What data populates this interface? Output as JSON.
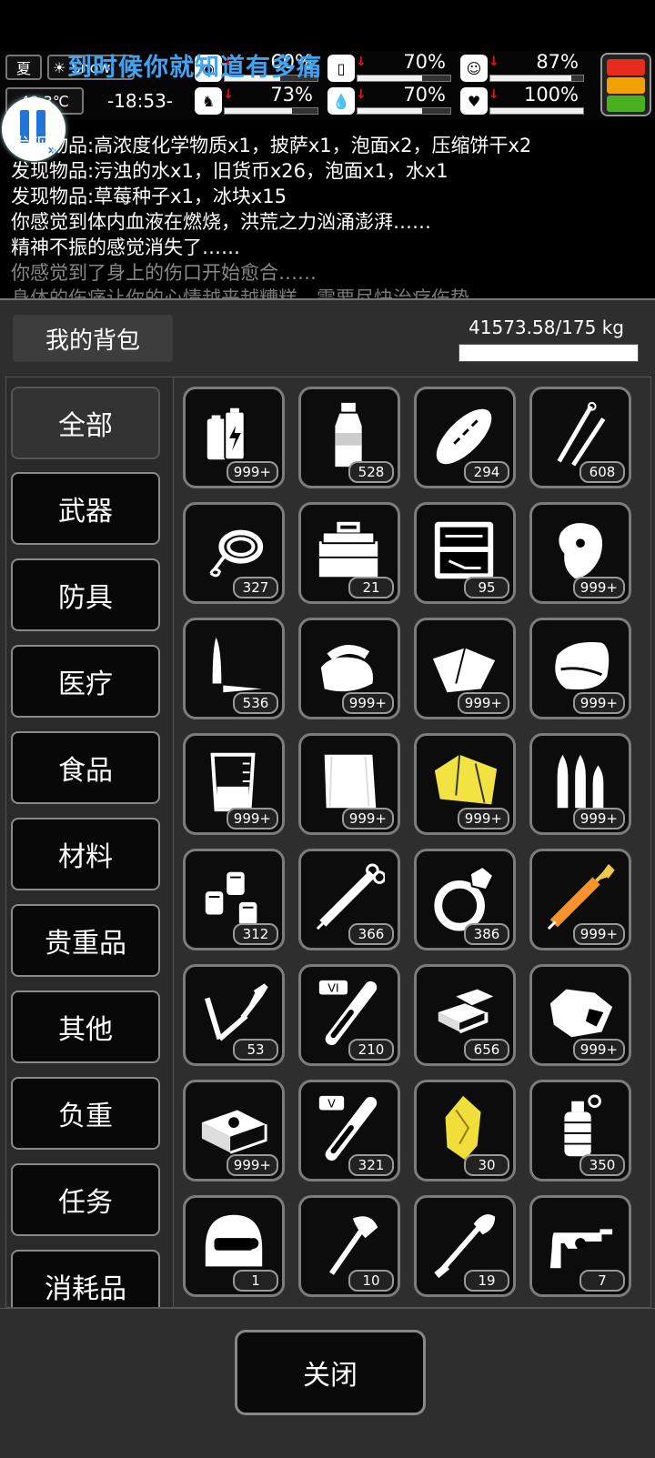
{
  "hud": {
    "season": "夏",
    "weather": "Snow",
    "temperature": "48.3℃",
    "time": "-18:53-",
    "stats": [
      {
        "icon": "stomach-icon",
        "value": "60%",
        "fill": 0.6
      },
      {
        "icon": "water-bottle-icon",
        "value": "70%",
        "fill": 0.7
      },
      {
        "icon": "face-icon",
        "value": "87%",
        "fill": 0.87
      },
      {
        "icon": "boot-icon",
        "value": "73%",
        "fill": 0.73
      },
      {
        "icon": "droplet-icon",
        "value": "70%",
        "fill": 0.7
      },
      {
        "icon": "heart-icon",
        "value": "100%",
        "fill": 1.0
      }
    ],
    "alert_colors": [
      "#e82c1b",
      "#f0a000",
      "#49b11f"
    ]
  },
  "banner": "到时候你就知道有多痛",
  "log": [
    "发现物品:高浓度化学物质x1，披萨x1，泡面x2，压缩饼干x2",
    "发现物品:污浊的水x1，旧货币x26，泡面x1，水x1",
    "发现物品:草莓种子x1，冰块x15",
    "你感觉到体内血液在燃烧，洪荒之力汹涌澎湃……",
    "精神不振的感觉消失了……",
    "你感觉到了身上的伤口开始愈合……",
    "身体的伤痛让你的心情越来越糟糕，需要尽快治疗伤势"
  ],
  "bag": {
    "title": "我的背包",
    "weight": "41573.58/175 kg"
  },
  "categories": [
    "全部",
    "武器",
    "防具",
    "医疗",
    "食品",
    "材料",
    "贵重品",
    "其他",
    "负重",
    "任务",
    "消耗品"
  ],
  "items": [
    {
      "icon": "batteries-icon",
      "count": "999+"
    },
    {
      "icon": "water-bottle-icon",
      "count": "528"
    },
    {
      "icon": "bread-icon",
      "count": "294"
    },
    {
      "icon": "needles-icon",
      "count": "608"
    },
    {
      "icon": "rope-icon",
      "count": "327"
    },
    {
      "icon": "toolbox-icon",
      "count": "21"
    },
    {
      "icon": "tool-case-icon",
      "count": "95"
    },
    {
      "icon": "raw-meat-icon",
      "count": "999+"
    },
    {
      "icon": "bullet-knife-icon",
      "count": "536"
    },
    {
      "icon": "cloth-stack-icon",
      "count": "999+"
    },
    {
      "icon": "folded-sheet-icon",
      "count": "999+"
    },
    {
      "icon": "towel-icon",
      "count": "999+"
    },
    {
      "icon": "beaker-icon",
      "count": "999+"
    },
    {
      "icon": "white-cloth-icon",
      "count": "999+"
    },
    {
      "icon": "yellow-cloth-icon",
      "count": "999+"
    },
    {
      "icon": "ammo-icon",
      "count": "999+"
    },
    {
      "icon": "chemical-bottles-icon",
      "count": "312"
    },
    {
      "icon": "syringe-icon",
      "count": "366"
    },
    {
      "icon": "diamond-ring-icon",
      "count": "386"
    },
    {
      "icon": "orange-syringe-icon",
      "count": "999+"
    },
    {
      "icon": "soldering-iron-icon",
      "count": "53"
    },
    {
      "icon": "test-tube-vi-icon",
      "count": "210"
    },
    {
      "icon": "gold-bars-icon",
      "count": "656"
    },
    {
      "icon": "ore-icon",
      "count": "999+"
    },
    {
      "icon": "cash-stack-icon",
      "count": "999+"
    },
    {
      "icon": "test-tube-v-icon",
      "count": "321"
    },
    {
      "icon": "gold-nugget-icon",
      "count": "30"
    },
    {
      "icon": "grenade-icon",
      "count": "350"
    },
    {
      "icon": "helmet-icon",
      "count": "1"
    },
    {
      "icon": "axe-icon",
      "count": "10"
    },
    {
      "icon": "shovel-icon",
      "count": "19"
    },
    {
      "icon": "revolver-icon",
      "count": "7"
    }
  ],
  "close_label": "关闭"
}
